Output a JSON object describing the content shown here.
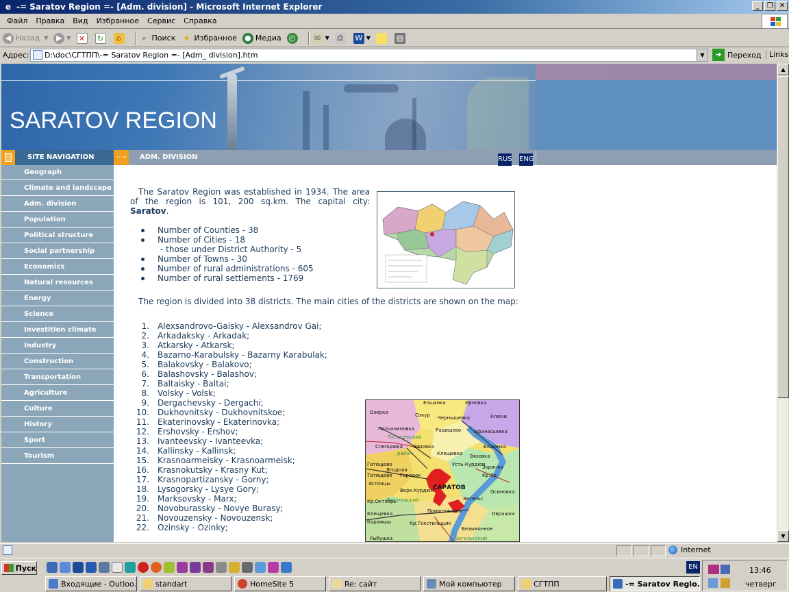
{
  "window": {
    "title": "-= Saratov Region =- [Adm. division] - Microsoft Internet Explorer",
    "buttons": [
      "_",
      "❐",
      "✕"
    ]
  },
  "menu": [
    "Файл",
    "Правка",
    "Вид",
    "Избранное",
    "Сервис",
    "Справка"
  ],
  "toolbar": {
    "back": "Назад",
    "search": "Поиск",
    "favorites": "Избранное",
    "media": "Медиа"
  },
  "address": {
    "label": "Адрес:",
    "value": "D:\\doc\\СГТПП\\-= Saratov Region =- [Adm_ division].htm",
    "go": "Переход",
    "links": "Links"
  },
  "page": {
    "site_title": "SARATOV REGION",
    "nav_title": "SITE NAVIGATION",
    "section_title": "ADM. DIVISION",
    "lang_rus": "RUS",
    "lang_eng": "ENG",
    "sidebar": [
      "Geograph",
      "Climate and landscape",
      "Adm. division",
      "Population",
      "Political structure",
      "Social partnership",
      "Economics",
      "Natural resources",
      "Energy",
      "Science",
      "Investition climate",
      "Industry",
      "Construction",
      "Transportation",
      "Agriculture",
      "Culture",
      "History",
      "Sport",
      "Tourism"
    ],
    "intro_text": "The Saratov Region was established in 1934. The area of the region is 101, 200 sq.km. The capital city:",
    "capital": "Saratov",
    "facts": [
      "Number of Counties - 38",
      "Number of Cities - 18",
      "- those under District Authority - 5",
      "Number of Towns - 30",
      "Number of rural administrations - 605",
      "Number of rural settlements - 1769"
    ],
    "districts_intro": "The region is divided into 38 districts. The main cities of the districts are shown on the map:",
    "districts": [
      "Alexsandrovo-Gaisky - Alexsandrov Gai;",
      "Arkadaksky - Arkadak;",
      "Atkarsky - Atkarsk;",
      "Bazarno-Karabulsky - Bazarny Karabulak;",
      "Balakovsky - Balakovo;",
      "Balashovsky - Balashov;",
      "Baltaisky - Baltai;",
      "Volsky - Volsk;",
      "Dergachevsky - Dergachi;",
      "Dukhovnitsky - Dukhovnitskoe;",
      "Ekaterinovsky - Ekaterinovka;",
      "Ershovsky - Ershov;",
      "Ivanteevsky - Ivanteevka;",
      "Kallinsky - Kallinsk;",
      "Krasnoarmeisky - Krasnoarmeisk;",
      "Krasnokutsky - Krasny Kut;",
      "Krasnopartizansky - Gorny;",
      "Lysogorsky - Lysye Gory;",
      "Marksovsky - Marx;",
      "Novoburassky - Novye Burasy;",
      "Novouzensky - Novouzensk;",
      "Ozinsky - Ozinky;"
    ],
    "map2_labels": [
      "Елшанка",
      "Ирновка",
      "Озерки",
      "Сокур",
      "Полчаниновка",
      "Чернышевка",
      "Ключи",
      "Радищево",
      "Афанасьевка",
      "Слепцовка",
      "Вязовка",
      "Елшанка",
      "Клещевка",
      "Вязовка",
      "Гатищево",
      "Усть-Курдюм",
      "Зоринка",
      "Кр.Яр",
      "Ягодная",
      "Татищево",
      "Городок",
      "Эстонцы",
      "Верх.Курдюм",
      "САРАТОВ",
      "Осиновка",
      "Энгельс",
      "Кр.Октябрь",
      "Клещевка",
      "Приволжский",
      "Оврашки",
      "Карамыш",
      "Кр.Текстильщик",
      "Безымянное",
      "Рыбушка",
      "Энгельсский",
      "Татищевский",
      "район",
      "Саратовский"
    ]
  },
  "statusbar": {
    "zone": "Internet"
  },
  "taskbar": {
    "start": "Пуск",
    "lang": "EN",
    "time": "13:46",
    "day": "четверг",
    "tasks": [
      "Входящие - Outloo...",
      "standart",
      "HomeSite 5",
      "Re: сайт",
      "Мой компьютер",
      "СГТПП",
      "-= Saratov Regio..."
    ]
  },
  "colors": {
    "nav_bg": "#8aa6b8",
    "banner": "#5f8fbf",
    "accent_orange": "#f0a020",
    "text": "#1a3a5a"
  }
}
